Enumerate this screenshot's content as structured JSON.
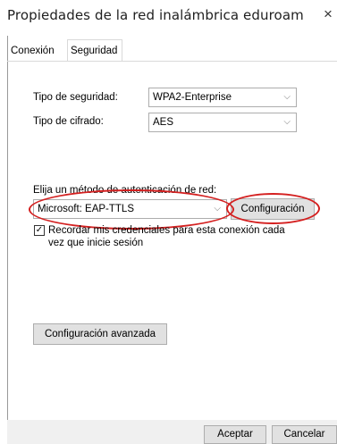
{
  "window": {
    "title": "Propiedades de la red inalámbrica eduroam",
    "close_glyph": "×"
  },
  "tabs": [
    {
      "label": "Conexión",
      "active": false
    },
    {
      "label": "Seguridad",
      "active": true
    }
  ],
  "security": {
    "type_label": "Tipo de seguridad:",
    "type_value": "WPA2-Enterprise",
    "cipher_label": "Tipo de cifrado:",
    "cipher_value": "AES"
  },
  "auth": {
    "prompt": "Elija un método de autenticación de red:",
    "method_value": "Microsoft: EAP-TTLS",
    "config_button": "Configuración",
    "remember_checked": true,
    "remember_line1": "Recordar mis credenciales para esta conexión cada",
    "remember_line2": "vez que inicie sesión"
  },
  "advanced_button": "Configuración avanzada",
  "footer": {
    "accept_button": "Aceptar",
    "cancel_button": "Cancelar"
  },
  "icons": {
    "chevron": "⌵",
    "check": "✓"
  },
  "colors": {
    "highlight": "#d42020"
  }
}
